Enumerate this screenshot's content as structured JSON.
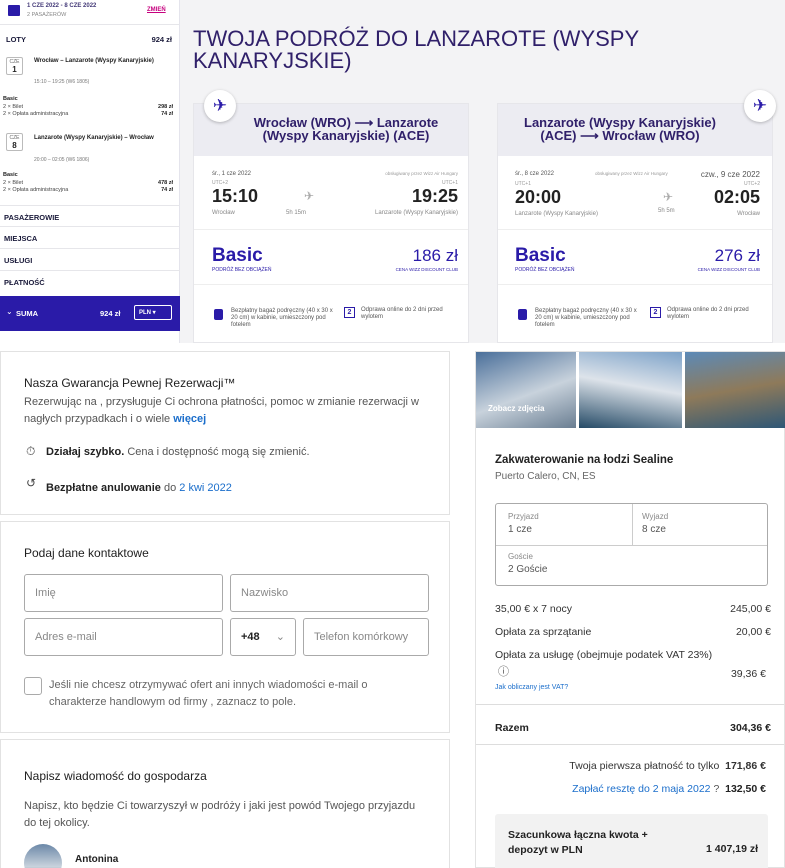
{
  "wizz": {
    "sidebar": {
      "dates": "1 CZE 2022 - 8 CZE 2022",
      "passengers": "2 PASAŻERÓW",
      "change_link": "ZMIEŃ",
      "flights_label": "LOTY",
      "flights_total": "924 zł",
      "outbound": {
        "day_abbr": "CZE",
        "day_num": "1",
        "route": "Wrocław – Lanzarote (Wyspy Kanaryjskie)",
        "time": "15:10 – 19:25 (W6 1805)",
        "fare": "Basic",
        "item1_label": "2 × Bilet",
        "item1_value": "298 zł",
        "item2_label": "2 × Opłata administracyjna",
        "item2_value": "74 zł"
      },
      "inbound": {
        "day_abbr": "CZE",
        "day_num": "8",
        "route": "Lanzarote (Wyspy Kanaryjskie) – Wrocław",
        "time": "20:00 – 02:05 (W6 1806)",
        "fare": "Basic",
        "item1_label": "2 × Bilet",
        "item1_value": "478 zł",
        "item2_label": "2 × Opłata administracyjna",
        "item2_value": "74 zł"
      },
      "sections": [
        "PASAŻEROWIE",
        "MIEJSCA",
        "USŁUGI",
        "PŁATNOŚĆ"
      ],
      "sum_label": "SUMA",
      "sum_value": "924 zł",
      "currency": "PLN"
    },
    "title": "TWOJA PODRÓŻ DO LANZAROTE (WYSPY KANARYJSKIE)",
    "outbound_card": {
      "route": "Wrocław (WRO) ⟶ Lanzarote (Wyspy Kanaryjskie) (ACE)",
      "dep_date": "śr., 1 cze 2022",
      "operated": "obsługiwany przez Wizz Air Hungary",
      "tz_dep": "UTC+2",
      "tz_arr": "UTC+1",
      "dep_time": "15:10",
      "arr_time": "19:25",
      "duration": "5h 15m",
      "dep_city": "Wrocław",
      "arr_city": "Lanzarote (Wyspy Kanaryjskie)",
      "fare": "Basic",
      "fare_sub": "PODRÓŻ BEZ OBCIĄŻEŃ",
      "price": "186 zł",
      "club": "CENA WIZZ DISCOUNT CLUB",
      "feature1": "Bezpłatny bagaż podręczny (40 x 30 x 20 cm) w kabinie, umieszczony pod fotelem",
      "feature2": "Odprawa online do 2 dni przed wylotem"
    },
    "inbound_card": {
      "route": "Lanzarote (Wyspy Kanaryjskie) (ACE) ⟶ Wrocław (WRO)",
      "dep_date": "śr., 8 cze 2022",
      "arr_date": "czw., 9 cze 2022",
      "operated": "obsługiwany przez Wizz Air Hungary",
      "tz_dep": "UTC+1",
      "tz_arr": "UTC+2",
      "dep_time": "20:00",
      "arr_time": "02:05",
      "duration": "5h 5m",
      "dep_city": "Lanzarote (Wyspy Kanaryjskie)",
      "arr_city": "Wrocław",
      "fare": "Basic",
      "fare_sub": "PODRÓŻ BEZ OBCIĄŻEŃ",
      "price": "276 zł",
      "club": "CENA WIZZ DISCOUNT CLUB",
      "feature1": "Bezpłatny bagaż podręczny (40 x 30 x 20 cm) w kabinie, umieszczony pod fotelem",
      "feature2": "Odprawa online do 2 dni przed wylotem"
    }
  },
  "booking": {
    "guarantee": {
      "title": "Nasza Gwarancja Pewnej Rezerwacji™",
      "text": "Rezerwując na , przysługuje Ci ochrona płatności, pomoc w zmianie rezerwacji w nagłych przypadkach i o wiele",
      "more": "więcej",
      "act_fast_bold": "Działaj szybko.",
      "act_fast_rest": "Cena i dostępność mogą się zmienić.",
      "cancel_bold": "Bezpłatne anulowanie",
      "cancel_mid": "do",
      "cancel_date": "2 kwi 2022"
    },
    "contact": {
      "title": "Podaj dane kontaktowe",
      "first_name": "Imię",
      "last_name": "Nazwisko",
      "email": "Adres e-mail",
      "prefix": "+48",
      "phone": "Telefon komórkowy",
      "optout": "Jeśli nie chcesz otrzymywać ofert ani innych wiadomości e-mail o charakterze handlowym od firmy , zaznacz to pole."
    },
    "message": {
      "title": "Napisz wiadomość do gospodarza",
      "text": "Napisz, kto będzie Ci towarzyszył w podróży i jaki jest powód Twojego przyjazdu do tej okolicy.",
      "host": "Antonina"
    }
  },
  "stay": {
    "photos_label": "Zobacz zdjęcia",
    "title": "Zakwaterowanie na łodzi Sealine",
    "location": "Puerto Calero, CN, ES",
    "checkin_label": "Przyjazd",
    "checkin": "1 cze",
    "checkout_label": "Wyjazd",
    "checkout": "8 cze",
    "guests_label": "Goście",
    "guests": "2 Goście",
    "lines": [
      {
        "label": "35,00 € x 7 nocy",
        "value": "245,00 €"
      },
      {
        "label": "Opłata za sprzątanie",
        "value": "20,00 €"
      },
      {
        "label": "Opłata za usługę (obejmuje podatek VAT 23%)",
        "value": "39,36 €"
      }
    ],
    "vat_link": "Jak obliczany jest VAT?",
    "total_label": "Razem",
    "total": "304,36 €",
    "first_pay_label": "Twoja pierwsza płatność to tylko",
    "first_pay": "171,86 €",
    "rest_label": "Zapłać resztę do 2 maja 2022",
    "rest": "132,50 €",
    "estimate_label": "Szacunkowa łączna kwota + depozyt w PLN",
    "estimate": "1 407,19 zł"
  }
}
